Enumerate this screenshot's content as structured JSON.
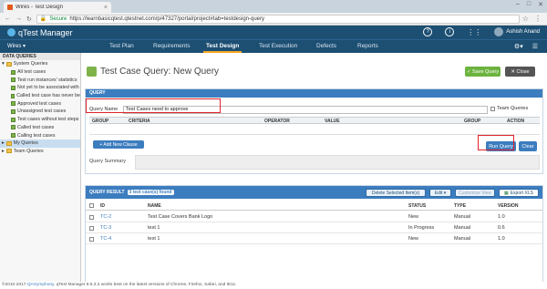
{
  "browser": {
    "tab_title": "Wires - Test Design",
    "tab_close": "×",
    "secure_label": "Secure",
    "url": "https://learnbasicqtest.qtestnet.com/p/47327/portal/project#tab=testdesign-query",
    "controls": [
      "–",
      "□",
      "✕"
    ]
  },
  "app": {
    "logo_text": "qTest Manager",
    "user_name": "Ashish Anand",
    "help_glyph": "?",
    "info_glyph": "i"
  },
  "nav": {
    "project": "Wires ▾",
    "items": [
      "Test Plan",
      "Requirements",
      "Test Design",
      "Test Execution",
      "Defects",
      "Reports"
    ],
    "active": "Test Design"
  },
  "sidebar": {
    "header": "DATA QUERIES",
    "system_queries": "System Queries",
    "system_items": [
      "All test cases",
      "Test run instances' statistics",
      "Not yet to be associated with",
      "Called test case has never be",
      "Approved test cases",
      "Unassigned test cases",
      "Test cases without test steps",
      "Called test cases",
      "Calling test cases"
    ],
    "my_queries": "My Queries",
    "team_queries": "Team Queries"
  },
  "page": {
    "title": "Test Case Query: New Query",
    "save_label": "✓ Save Query",
    "close_label": "✕ Close"
  },
  "query": {
    "panel_title": "QUERY",
    "name_label": "Query Name",
    "name_value": "Test Cases need to approve",
    "team_label": "Team Queries",
    "columns": [
      "GROUP",
      "CRITERIA",
      "OPERATOR",
      "VALUE",
      "GROUP",
      "ACTION"
    ],
    "add_clause": "+ Add New Clause",
    "run_label": "Run Query",
    "clear_label": "Clear",
    "summary_label": "Query Summary"
  },
  "results": {
    "title": "QUERY RESULT",
    "count": "3 test case(s) found",
    "delete_label": "Delete Selected Item(s)",
    "edit_label": "Edit ▾",
    "customize_label": "Customize View",
    "export_label": "Export XLS",
    "columns": [
      "ID",
      "NAME",
      "STATUS",
      "TYPE",
      "VERSION"
    ],
    "rows": [
      {
        "id": "TC-2",
        "name": "Test Case Covers Bank Logo",
        "status": "New",
        "type": "Manual",
        "version": "1.0"
      },
      {
        "id": "TC-3",
        "name": "test 1",
        "status": "In Progress",
        "type": "Manual",
        "version": "0.6"
      },
      {
        "id": "TC-4",
        "name": "test 1",
        "status": "New",
        "type": "Manual",
        "version": "1.0"
      }
    ]
  },
  "footer": {
    "copyright": "©2010-2017",
    "company": "QASymphony",
    "text": ". qTest Manager 8.5.3.2 works best on the latest versions of Chrome, Firefox, Safari, and IE11."
  },
  "colors": {
    "header_bg": "#1d4f73",
    "accent_blue": "#3c7dbf",
    "save_green": "#6db33f",
    "highlight_red": "#e0232b"
  }
}
